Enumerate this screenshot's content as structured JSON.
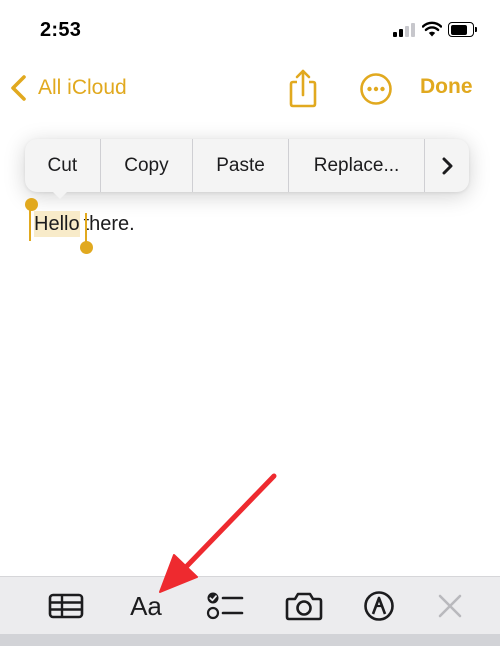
{
  "status_bar": {
    "time": "2:53",
    "icons": [
      "cellular-signal-icon",
      "wifi-icon",
      "battery-icon"
    ]
  },
  "nav": {
    "back_label": "All iCloud",
    "done_label": "Done",
    "icons": [
      "chevron-left-icon",
      "share-icon",
      "more-circle-icon"
    ],
    "accent_color": "#e1a91f"
  },
  "note": {
    "selected_text": "Hello",
    "rest_text": "there.",
    "selection_color": "#f8ebc9"
  },
  "edit_menu": {
    "items": [
      "Cut",
      "Copy",
      "Paste",
      "Replace..."
    ],
    "more_icon": "chevron-right-icon"
  },
  "toolbar": {
    "format_label": "Aa",
    "icons": [
      "table-icon",
      "checklist-icon",
      "camera-icon",
      "markup-pen-icon",
      "close-x-icon"
    ]
  },
  "annotation": {
    "arrow_color": "#ee2a2f"
  }
}
